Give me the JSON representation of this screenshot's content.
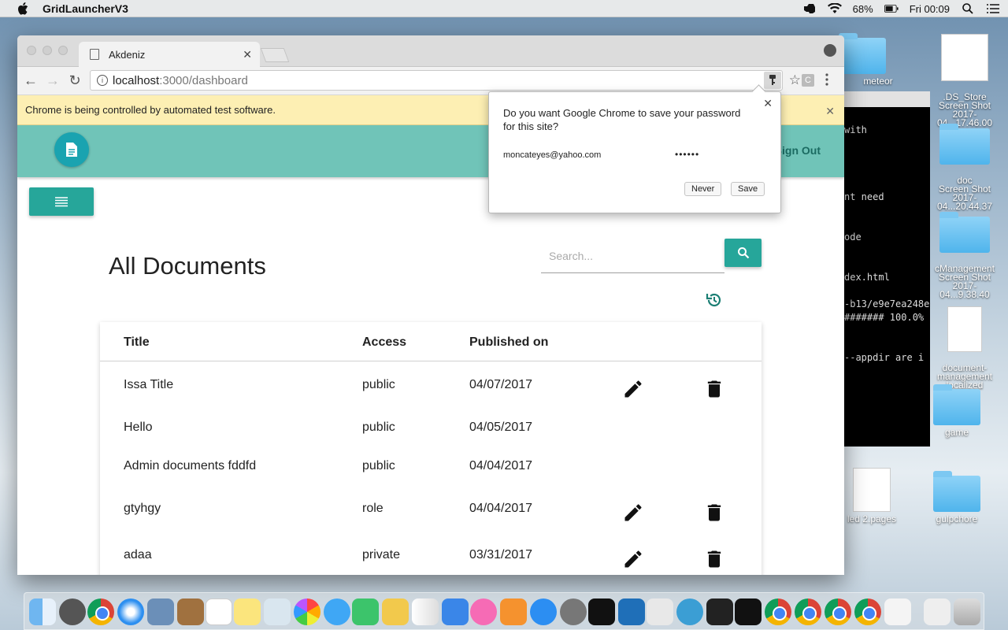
{
  "menubar": {
    "app_name": "GridLauncherV3",
    "battery": "68%",
    "clock": "Fri 00:09"
  },
  "desktop": {
    "items": [
      {
        "label": "meteor"
      },
      {
        "label": ".DS_Store\nScreen Shot\n2017-04...17.46.00"
      },
      {
        "label": "doc\nScreen Shot\n2017-04...20.44.37"
      },
      {
        "label": "cManagement\nScreen Shot\n2017-04...9.38.40"
      },
      {
        "label": "document-\nmanagement\nlocalized"
      },
      {
        "label": "game"
      },
      {
        "label": "led 2.pages"
      },
      {
        "label": "gulpchore"
      }
    ],
    "terminal_lines": [
      "with",
      "nt need",
      "ode",
      "dex.html",
      "-b13/e9e7ea248e",
      "####### 100.0%",
      "--appdir are i"
    ]
  },
  "browser": {
    "tab_title": "Akdeniz",
    "url_host": "localhost",
    "url_path": ":3000/dashboard",
    "ext_label": "C",
    "infobar_text": "Chrome is being controlled by automated test software."
  },
  "password_popup": {
    "question": "Do you want Google Chrome to save your password for this site?",
    "username": "moncateyes@yahoo.com",
    "password_mask": "••••••",
    "never_label": "Never",
    "save_label": "Save"
  },
  "app": {
    "signout_label": "Sign Out",
    "page_title": "All Documents",
    "search_placeholder": "Search...",
    "table": {
      "headers": {
        "title": "Title",
        "access": "Access",
        "published": "Published on"
      },
      "rows": [
        {
          "title": "Issa Title",
          "access": "public",
          "date": "04/07/2017",
          "editable": true
        },
        {
          "title": "Hello",
          "access": "public",
          "date": "04/05/2017",
          "editable": false
        },
        {
          "title": "Admin documents fddfd",
          "access": "public",
          "date": "04/04/2017",
          "editable": false
        },
        {
          "title": "gtyhgy",
          "access": "role",
          "date": "04/04/2017",
          "editable": true
        },
        {
          "title": "adaa",
          "access": "private",
          "date": "03/31/2017",
          "editable": true
        }
      ]
    }
  },
  "colors": {
    "appbar": "#70c4b8",
    "teal_button": "#26a69a",
    "logo": "#1aa3b0",
    "infobar": "#fdefb3"
  }
}
